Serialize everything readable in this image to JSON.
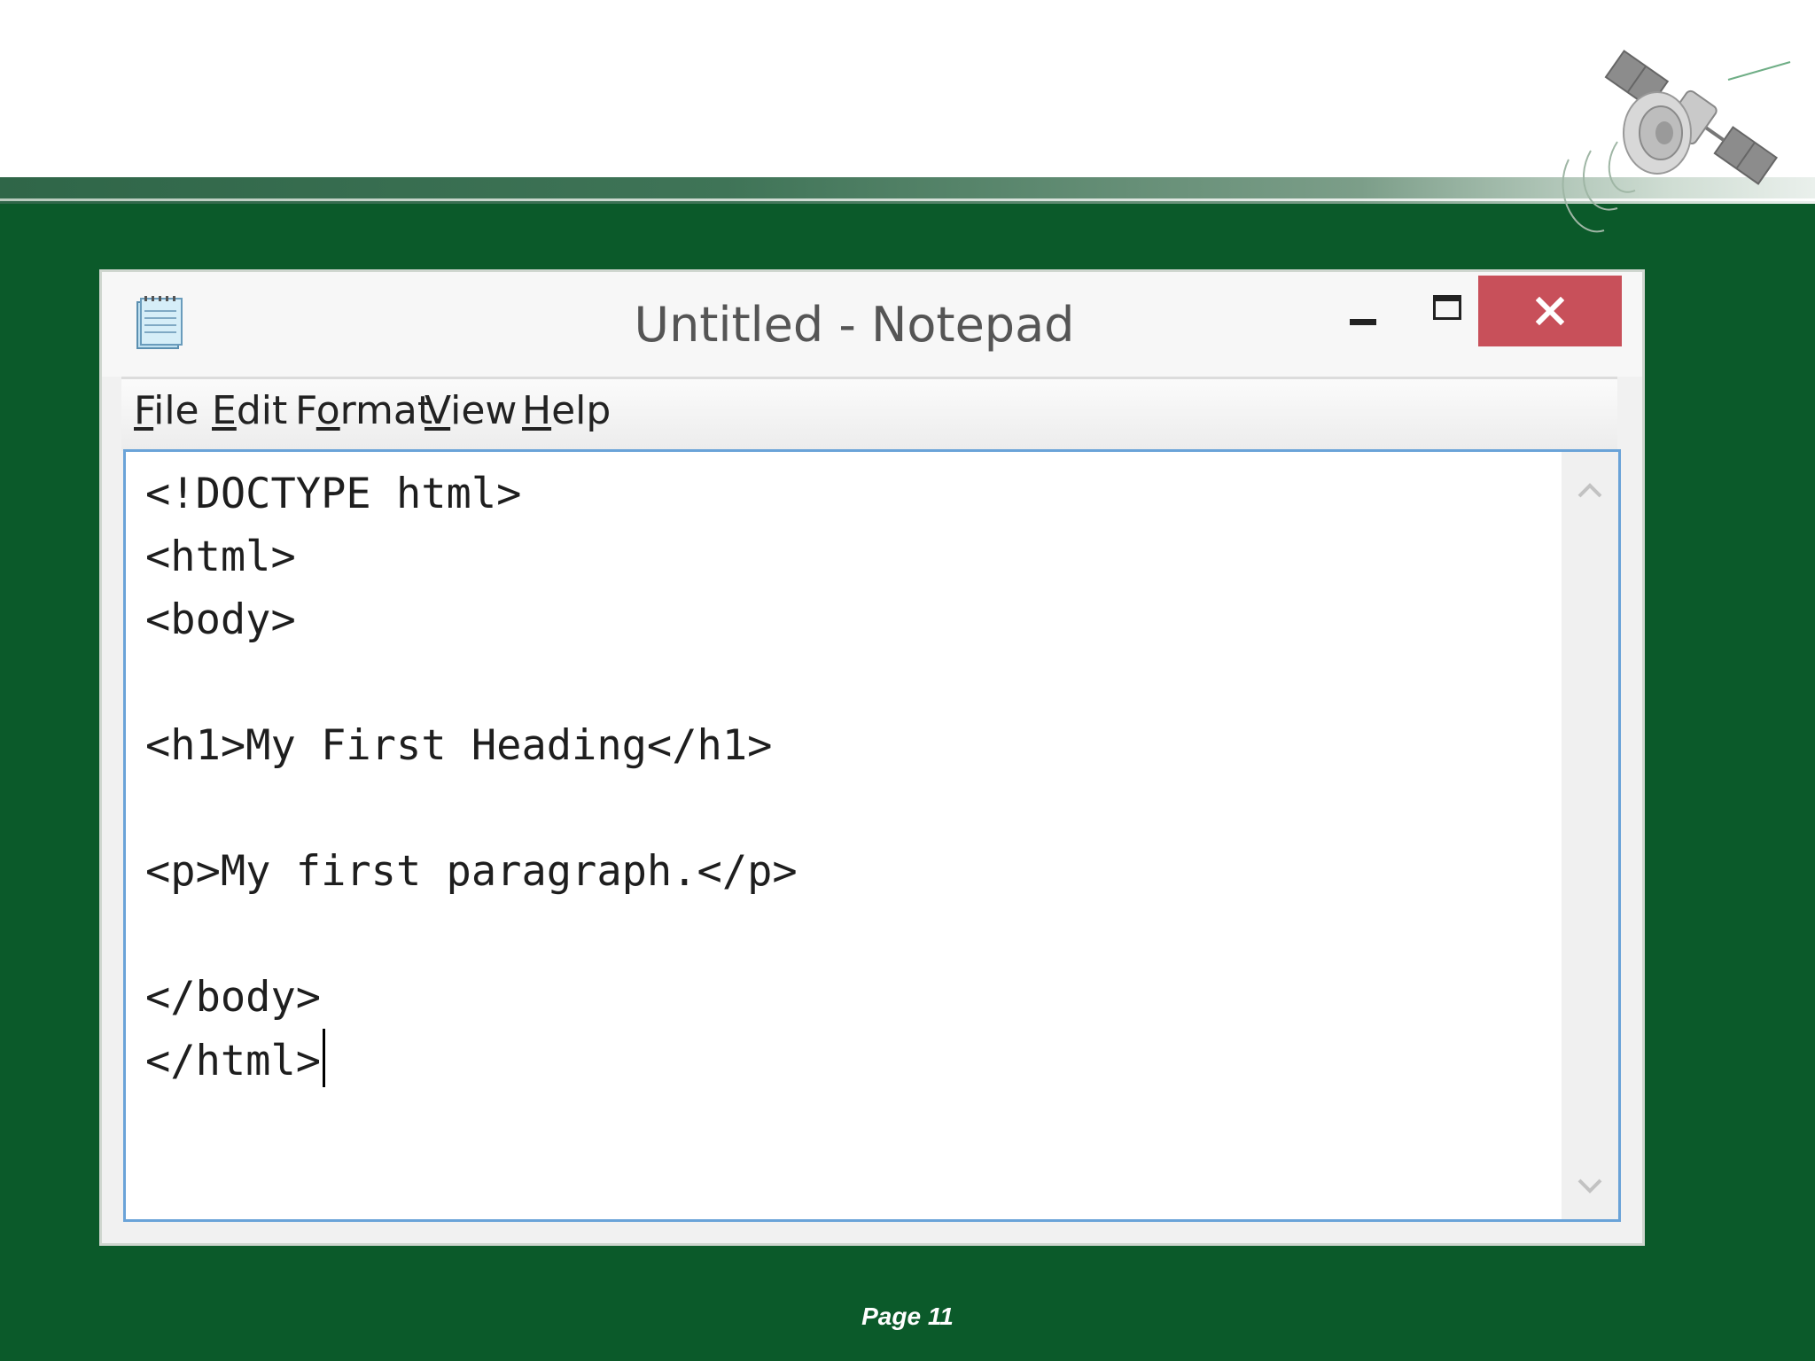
{
  "window": {
    "title": "Untitled - Notepad"
  },
  "menu": {
    "items": [
      {
        "accel": "F",
        "rest": "ile"
      },
      {
        "accel": "E",
        "rest": "dit"
      },
      {
        "pre": "F",
        "accel": "o",
        "rest": "rmat"
      },
      {
        "accel": "V",
        "rest": "iew"
      },
      {
        "accel": "H",
        "rest": "elp"
      }
    ]
  },
  "editor": {
    "content": "<!DOCTYPE html>\n<html>\n<body>\n\n<h1>My First Heading</h1>\n\n<p>My first paragraph.</p>\n\n</body>\n</html>"
  },
  "footer": {
    "page_label": "Page  11"
  },
  "colors": {
    "slide_background": "#0b5a2a",
    "close_button": "#c8505a",
    "editor_border": "#6aa3d8"
  },
  "icons": [
    "notepad-icon",
    "minimize-icon",
    "maximize-icon",
    "close-icon",
    "scroll-up-arrow-icon",
    "scroll-down-arrow-icon",
    "satellite-logo"
  ]
}
